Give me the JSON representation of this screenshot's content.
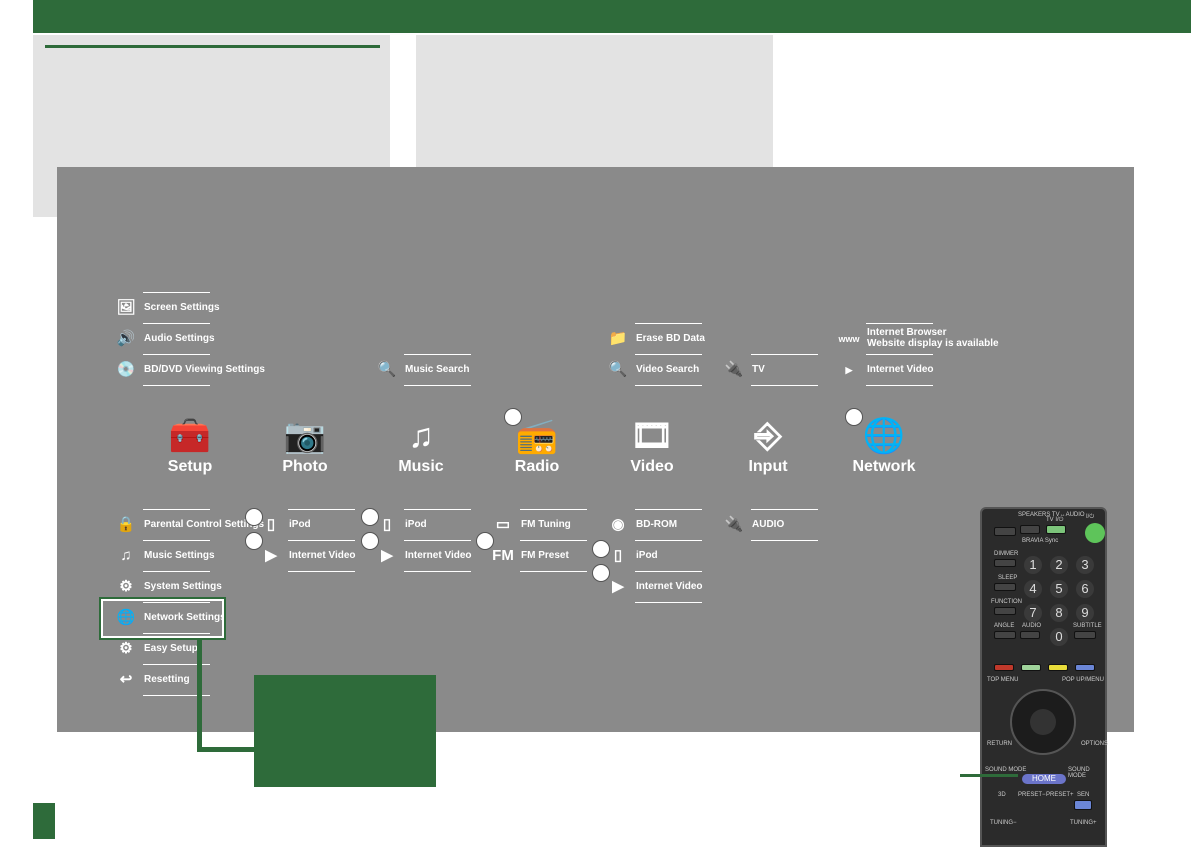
{
  "categories": [
    {
      "label": "Setup",
      "icon": "toolbox-icon"
    },
    {
      "label": "Photo",
      "icon": "camera-icon"
    },
    {
      "label": "Music",
      "icon": "music-note-icon"
    },
    {
      "label": "Radio",
      "icon": "radio-icon"
    },
    {
      "label": "Video",
      "icon": "film-icon"
    },
    {
      "label": "Input",
      "icon": "input-icon"
    },
    {
      "label": "Network",
      "icon": "globe-icon"
    }
  ],
  "setup_top": [
    "Screen Settings",
    "Audio Settings",
    "BD/DVD Viewing Settings"
  ],
  "setup_bottom": [
    "Parental Control Settings",
    "Music Settings",
    "System Settings",
    "Network Settings",
    "Easy Setup",
    "Resetting"
  ],
  "photo_items": [
    "iPod",
    "Internet Video"
  ],
  "music_top": [
    "Music Search"
  ],
  "music_items": [
    "iPod",
    "Internet Video"
  ],
  "radio_items": [
    "FM Tuning",
    "FM Preset"
  ],
  "video_top": [
    "Erase BD Data",
    "Video Search"
  ],
  "video_items": [
    "BD-ROM",
    "iPod",
    "Internet Video"
  ],
  "input_top": [
    "TV"
  ],
  "input_items": [
    "AUDIO"
  ],
  "network_top": [
    "Internet Browser",
    "Website display is available",
    "Internet Video"
  ],
  "remote": {
    "speakers": "SPEAKERS TV↔AUDIO",
    "tv": "TV I/⏻",
    "power": "I/⏻",
    "bravia": "BRAVIA Sync",
    "dimmer": "DIMMER",
    "sleep": "SLEEP",
    "function": "FUNCTION",
    "angle": "ANGLE",
    "audio": "AUDIO",
    "subtitle": "SUBTITLE",
    "numbers": [
      "1",
      "2",
      "3",
      "4",
      "5",
      "6",
      "7",
      "8",
      "9",
      "0"
    ],
    "top_menu": "TOP MENU",
    "popup": "POP UP/MENU",
    "return": "RETURN",
    "options": "OPTIONS",
    "sound_mode_l": "SOUND MODE",
    "sound_mode_r": "SOUND MODE",
    "home": "HOME",
    "three_d": "3D",
    "preset_minus": "PRESET−",
    "preset_plus": "PRESET+",
    "sen": "SEN",
    "tuning_minus": "TUNING−",
    "tuning_plus": "TUNING+"
  },
  "colors": {
    "brand_green": "#2e6b3a",
    "panel_gray": "#8a8a8a",
    "home_blue": "#6b74c9"
  }
}
